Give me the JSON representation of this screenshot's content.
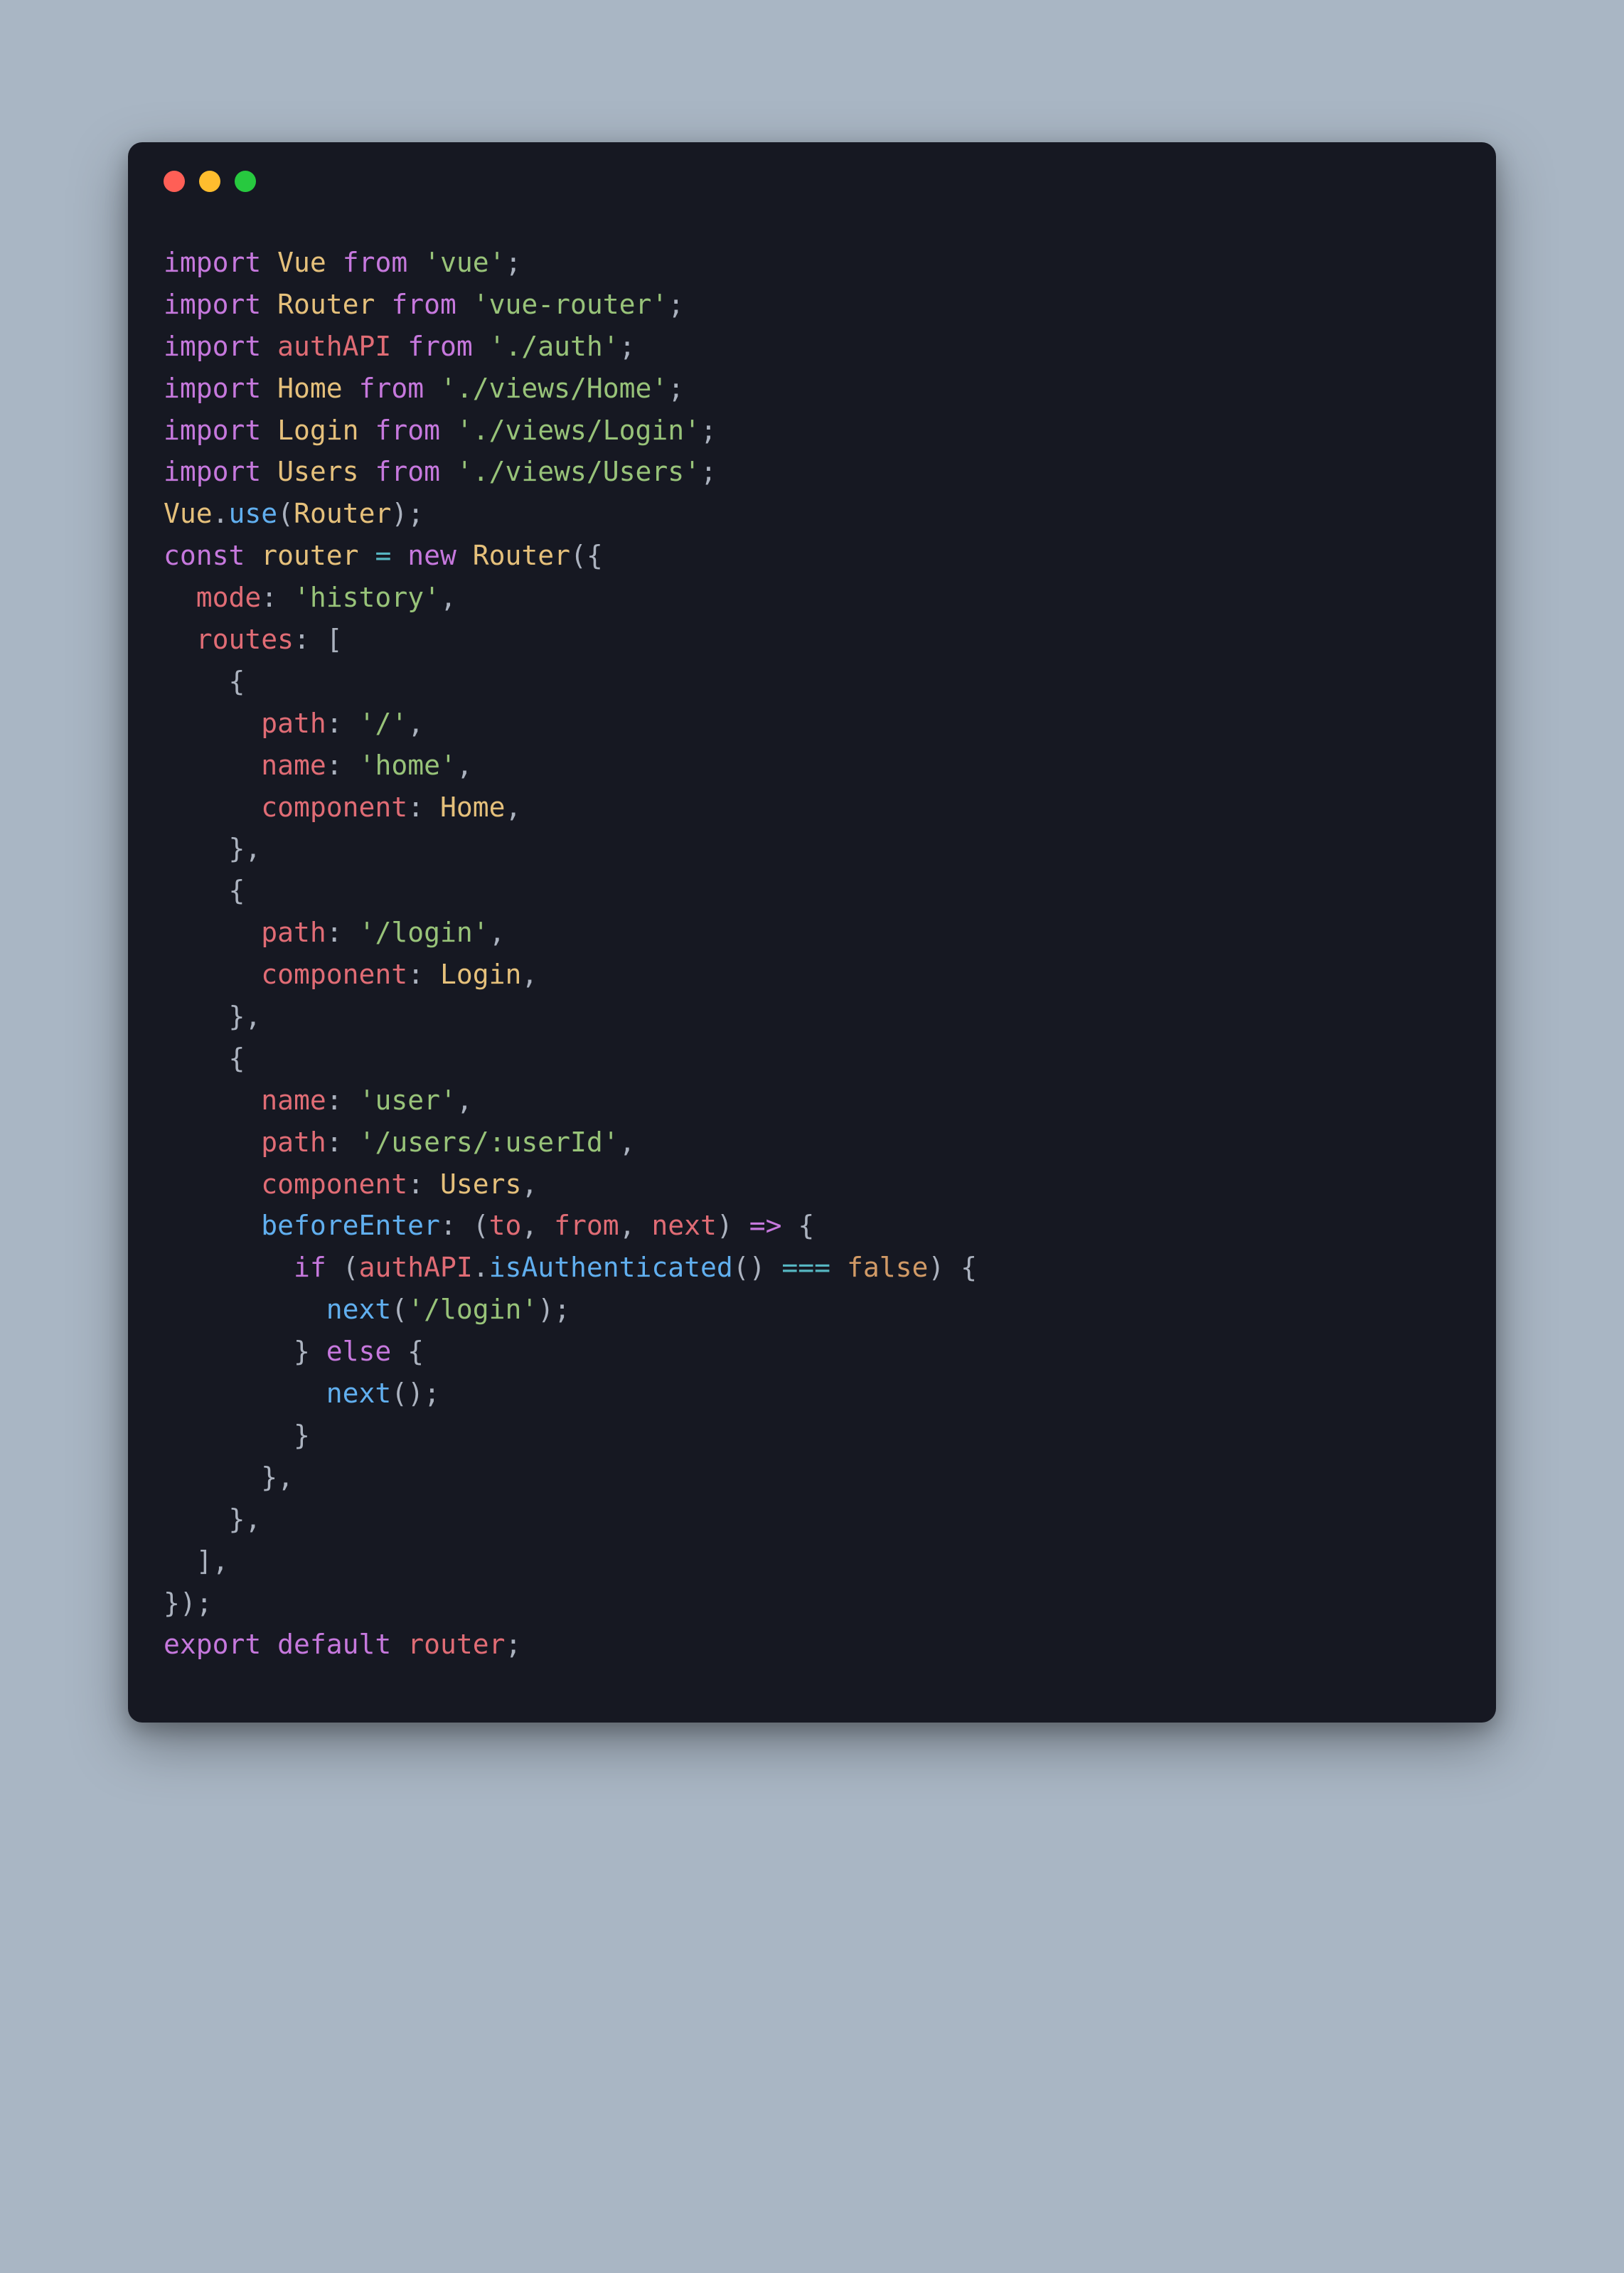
{
  "colors": {
    "bg": "#a9b6c4",
    "editor_bg": "#161822",
    "close": "#ff5f56",
    "minimize": "#ffbd2e",
    "maximize": "#27c93f",
    "keyword": "#c678dd",
    "class": "#e5c07b",
    "string": "#98c379",
    "property": "#e06c75",
    "function": "#61afef",
    "method": "#56b6c2",
    "bool": "#d19a66",
    "default": "#abb2bf"
  },
  "code": {
    "tokens": [
      [
        [
          "import ",
          "keyword"
        ],
        [
          "Vue",
          "class"
        ],
        [
          " ",
          "punct"
        ],
        [
          "from",
          "keyword"
        ],
        [
          " ",
          "punct"
        ],
        [
          "'vue'",
          "string"
        ],
        [
          ";",
          "punct"
        ]
      ],
      [
        [
          "import ",
          "keyword"
        ],
        [
          "Router",
          "class"
        ],
        [
          " ",
          "punct"
        ],
        [
          "from",
          "keyword"
        ],
        [
          " ",
          "punct"
        ],
        [
          "'vue-router'",
          "string"
        ],
        [
          ";",
          "punct"
        ]
      ],
      [
        [
          "import ",
          "keyword"
        ],
        [
          "authAPI",
          "property"
        ],
        [
          " ",
          "punct"
        ],
        [
          "from",
          "keyword"
        ],
        [
          " ",
          "punct"
        ],
        [
          "'./auth'",
          "string"
        ],
        [
          ";",
          "punct"
        ]
      ],
      [
        [
          "import ",
          "keyword"
        ],
        [
          "Home",
          "class"
        ],
        [
          " ",
          "punct"
        ],
        [
          "from",
          "keyword"
        ],
        [
          " ",
          "punct"
        ],
        [
          "'./views/Home'",
          "string"
        ],
        [
          ";",
          "punct"
        ]
      ],
      [
        [
          "import ",
          "keyword"
        ],
        [
          "Login",
          "class"
        ],
        [
          " ",
          "punct"
        ],
        [
          "from",
          "keyword"
        ],
        [
          " ",
          "punct"
        ],
        [
          "'./views/Login'",
          "string"
        ],
        [
          ";",
          "punct"
        ]
      ],
      [
        [
          "import ",
          "keyword"
        ],
        [
          "Users",
          "class"
        ],
        [
          " ",
          "punct"
        ],
        [
          "from",
          "keyword"
        ],
        [
          " ",
          "punct"
        ],
        [
          "'./views/Users'",
          "string"
        ],
        [
          ";",
          "punct"
        ]
      ],
      [
        [
          "Vue",
          "class"
        ],
        [
          ".",
          "punct"
        ],
        [
          "use",
          "function"
        ],
        [
          "(",
          "punct"
        ],
        [
          "Router",
          "class"
        ],
        [
          ");",
          "punct"
        ]
      ],
      [
        [
          "const ",
          "keyword"
        ],
        [
          "router",
          "variable"
        ],
        [
          " ",
          "punct"
        ],
        [
          "=",
          "operator"
        ],
        [
          " ",
          "punct"
        ],
        [
          "new ",
          "keyword"
        ],
        [
          "Router",
          "class"
        ],
        [
          "({",
          "punct"
        ]
      ],
      [
        [
          "  ",
          "punct"
        ],
        [
          "mode",
          "property"
        ],
        [
          ": ",
          "punct"
        ],
        [
          "'history'",
          "string"
        ],
        [
          ",",
          "punct"
        ]
      ],
      [
        [
          "  ",
          "punct"
        ],
        [
          "routes",
          "property"
        ],
        [
          ": [",
          "punct"
        ]
      ],
      [
        [
          "    {",
          "punct"
        ]
      ],
      [
        [
          "      ",
          "punct"
        ],
        [
          "path",
          "property"
        ],
        [
          ": ",
          "punct"
        ],
        [
          "'/'",
          "string"
        ],
        [
          ",",
          "punct"
        ]
      ],
      [
        [
          "      ",
          "punct"
        ],
        [
          "name",
          "property"
        ],
        [
          ": ",
          "punct"
        ],
        [
          "'home'",
          "string"
        ],
        [
          ",",
          "punct"
        ]
      ],
      [
        [
          "      ",
          "punct"
        ],
        [
          "component",
          "property"
        ],
        [
          ": ",
          "punct"
        ],
        [
          "Home",
          "class"
        ],
        [
          ",",
          "punct"
        ]
      ],
      [
        [
          "    },",
          "punct"
        ]
      ],
      [
        [
          "    {",
          "punct"
        ]
      ],
      [
        [
          "      ",
          "punct"
        ],
        [
          "path",
          "property"
        ],
        [
          ": ",
          "punct"
        ],
        [
          "'/login'",
          "string"
        ],
        [
          ",",
          "punct"
        ]
      ],
      [
        [
          "      ",
          "punct"
        ],
        [
          "component",
          "property"
        ],
        [
          ": ",
          "punct"
        ],
        [
          "Login",
          "class"
        ],
        [
          ",",
          "punct"
        ]
      ],
      [
        [
          "    },",
          "punct"
        ]
      ],
      [
        [
          "    {",
          "punct"
        ]
      ],
      [
        [
          "      ",
          "punct"
        ],
        [
          "name",
          "property"
        ],
        [
          ": ",
          "punct"
        ],
        [
          "'user'",
          "string"
        ],
        [
          ",",
          "punct"
        ]
      ],
      [
        [
          "      ",
          "punct"
        ],
        [
          "path",
          "property"
        ],
        [
          ": ",
          "punct"
        ],
        [
          "'/users/:userId'",
          "string"
        ],
        [
          ",",
          "punct"
        ]
      ],
      [
        [
          "      ",
          "punct"
        ],
        [
          "component",
          "property"
        ],
        [
          ": ",
          "punct"
        ],
        [
          "Users",
          "class"
        ],
        [
          ",",
          "punct"
        ]
      ],
      [
        [
          "      ",
          "punct"
        ],
        [
          "beforeEnter",
          "function"
        ],
        [
          ": (",
          "punct"
        ],
        [
          "to",
          "property"
        ],
        [
          ", ",
          "punct"
        ],
        [
          "from",
          "property"
        ],
        [
          ", ",
          "punct"
        ],
        [
          "next",
          "property"
        ],
        [
          ") ",
          "punct"
        ],
        [
          "=>",
          "keyword"
        ],
        [
          " {",
          "punct"
        ]
      ],
      [
        [
          "        ",
          "punct"
        ],
        [
          "if ",
          "keyword"
        ],
        [
          "(",
          "punct"
        ],
        [
          "authAPI",
          "property"
        ],
        [
          ".",
          "punct"
        ],
        [
          "isAuthenticated",
          "function"
        ],
        [
          "() ",
          "punct"
        ],
        [
          "===",
          "operator"
        ],
        [
          " ",
          "punct"
        ],
        [
          "false",
          "bool"
        ],
        [
          ") {",
          "punct"
        ]
      ],
      [
        [
          "          ",
          "punct"
        ],
        [
          "next",
          "function"
        ],
        [
          "(",
          "punct"
        ],
        [
          "'/login'",
          "string"
        ],
        [
          ");",
          "punct"
        ]
      ],
      [
        [
          "        } ",
          "punct"
        ],
        [
          "else ",
          "keyword"
        ],
        [
          "{",
          "punct"
        ]
      ],
      [
        [
          "          ",
          "punct"
        ],
        [
          "next",
          "function"
        ],
        [
          "();",
          "punct"
        ]
      ],
      [
        [
          "        }",
          "punct"
        ]
      ],
      [
        [
          "      },",
          "punct"
        ]
      ],
      [
        [
          "    },",
          "punct"
        ]
      ],
      [
        [
          "  ],",
          "punct"
        ]
      ],
      [
        [
          "});",
          "punct"
        ]
      ],
      [
        [
          "export ",
          "keyword"
        ],
        [
          "default ",
          "keyword"
        ],
        [
          "router",
          "property"
        ],
        [
          ";",
          "punct"
        ]
      ]
    ]
  }
}
